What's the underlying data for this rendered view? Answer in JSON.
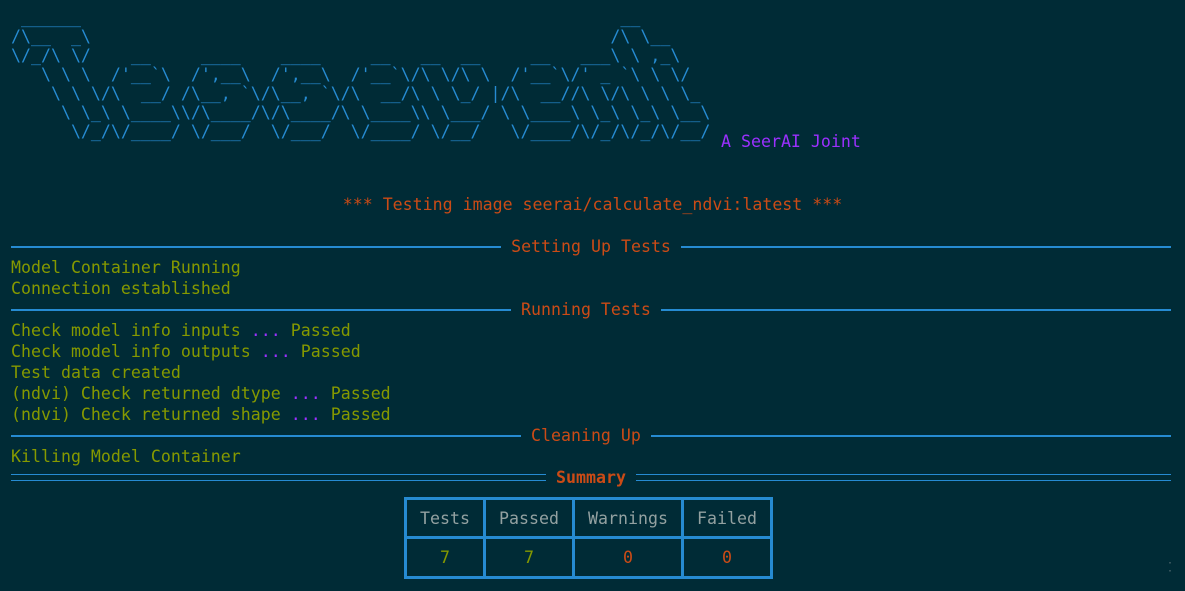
{
  "tagline": "A SeerAI Joint",
  "testing_banner": "*** Testing image seerai/calculate_ndvi:latest ***",
  "sections": {
    "setup": {
      "title": "Setting Up Tests",
      "messages": [
        "Model Container Running",
        "Connection established"
      ]
    },
    "running": {
      "title": "Running Tests",
      "checks": [
        {
          "text": "Check model info inputs",
          "dots": "...",
          "result": "Passed"
        },
        {
          "text": "Check model info outputs",
          "dots": "...",
          "result": "Passed"
        },
        {
          "text": "Test data created",
          "dots": "",
          "result": ""
        },
        {
          "text": "(ndvi) Check returned dtype",
          "dots": "...",
          "result": "Passed"
        },
        {
          "text": "(ndvi) Check returned shape",
          "dots": "...",
          "result": "Passed"
        }
      ]
    },
    "cleanup": {
      "title": "Cleaning Up",
      "messages": [
        "Killing Model Container"
      ]
    },
    "summary": {
      "title": "Summary",
      "headers": [
        "Tests",
        "Passed",
        "Warnings",
        "Failed"
      ],
      "values": [
        "7",
        "7",
        "0",
        "0"
      ]
    }
  },
  "colors": {
    "background": "#002b36",
    "blue": "#268bd2",
    "green": "#859900",
    "orange": "#cb4b16",
    "purple": "#9b30ff"
  }
}
